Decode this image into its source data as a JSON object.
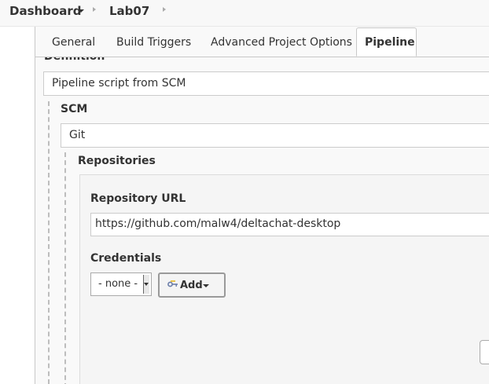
{
  "breadcrumb": {
    "dashboard": "Dashboard",
    "job": "Lab07"
  },
  "tabs": [
    {
      "label": "General"
    },
    {
      "label": "Build Triggers"
    },
    {
      "label": "Advanced Project Options"
    },
    {
      "label": "Pipeline",
      "active": true
    }
  ],
  "pipeline": {
    "definition_label": "Definition",
    "definition_value": "Pipeline script from SCM",
    "scm_label": "SCM",
    "scm_value": "Git",
    "repositories_label": "Repositories",
    "repository_url_label": "Repository URL",
    "repository_url_value": "https://github.com/malw4/deltachat-desktop",
    "credentials_label": "Credentials",
    "credentials_selected": "- none -",
    "add_button_label": "Add"
  },
  "icons": {
    "key": "key-icon",
    "dropdown": "chevron-down-icon",
    "separator": "chevron-right-icon"
  },
  "colors": {
    "panel_bg": "#f9f9f9",
    "border": "#c8c8c8"
  }
}
